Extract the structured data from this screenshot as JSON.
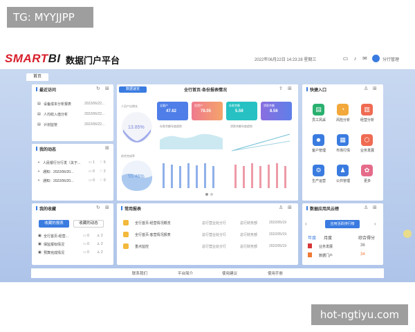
{
  "overlay": {
    "tag": "TG: MYYJJPP",
    "site": "hot-ngtiyu.com"
  },
  "header": {
    "logo_left": "SMART",
    "logo_right": "BI",
    "title": "数据门户平台",
    "datetime": "2022年06月22日 14:23:28 星期三",
    "user": "分行管理",
    "icons": [
      "monitor-icon",
      "bell-icon",
      "message-icon",
      "settings-icon"
    ]
  },
  "tabs": {
    "home": "首页"
  },
  "recent": {
    "title": "最近访问",
    "items": [
      {
        "name": "设备成本分析报表",
        "date": "2022/06/22..."
      },
      {
        "name": "人均收入值分析",
        "date": "2022/06/22..."
      },
      {
        "name": "计划监管",
        "date": "2022/06/22..."
      }
    ]
  },
  "dynamics": {
    "title": "我的动态",
    "items": [
      {
        "text": "人民银行分行发（关于...",
        "like": "1",
        "comment": "5"
      },
      {
        "text": "通知：2022/06/20...",
        "like": "0",
        "comment": "2"
      },
      {
        "text": "通知：2022/06/20...",
        "like": "0",
        "comment": "0"
      }
    ]
  },
  "favorites": {
    "title": "我的收藏",
    "tab_active": "收藏的报表",
    "tab_other": "收藏的动态",
    "items": [
      {
        "text": "全行首页-经营...",
        "a": "0",
        "b": "2"
      },
      {
        "text": "保监报标情况",
        "a": "0",
        "b": "2"
      },
      {
        "text": "预算完成情况",
        "a": "0",
        "b": "2"
      }
    ]
  },
  "dashboard": {
    "title": "数据速览",
    "subtitle": "全行首页-各份报表情况",
    "ring_pct": "13.85%",
    "wave_pct": "55.46%",
    "ring_label": "人员产出增长",
    "wave_label": "综合完成率",
    "cards": [
      {
        "label": "全量户",
        "value": "47.62",
        "color": "#4f7ee8"
      },
      {
        "label": "信贷户",
        "value": "78.05",
        "color": "#ef7a8e"
      },
      {
        "label": "存款余额",
        "value": "5.59",
        "color": "#27c1c3"
      },
      {
        "label": "贷款余额",
        "value": "8.56",
        "color": "#8a6ee0"
      }
    ],
    "mini_chart1": "存款余额年度趋势",
    "mini_chart2": "贷款余额年度趋势"
  },
  "reports": {
    "title": "常用报表",
    "rows": [
      {
        "name": "全行首页-经营情况概览",
        "org": "总行营业处分行",
        "dept": "总行财务部",
        "date": "2022/05/19"
      },
      {
        "name": "全行首页-客营情况报表",
        "org": "总行营业处分行",
        "dept": "总行财务部",
        "date": "2022/05/19"
      },
      {
        "name": "重点监控",
        "org": "总行营业处分行",
        "dept": "总行财务部",
        "date": "2022/05/19"
      }
    ]
  },
  "quick": {
    "title": "快捷入口",
    "items": [
      {
        "label": "员工风采",
        "color": "#29b06f",
        "icon": "▤",
        "name": "staff-icon"
      },
      {
        "label": "风险分析",
        "color": "#f3a83b",
        "icon": "◔",
        "name": "risk-icon"
      },
      {
        "label": "经营分析",
        "color": "#ef6b52",
        "icon": "▥",
        "name": "analysis-icon"
      },
      {
        "label": "客户管理",
        "color": "#3a7be0",
        "icon": "☻",
        "name": "customer-icon"
      },
      {
        "label": "市场行情",
        "color": "#3a7be0",
        "icon": "▦",
        "name": "market-icon"
      },
      {
        "label": "业务发展",
        "color": "#ef6b52",
        "icon": "⬡",
        "name": "business-icon"
      },
      {
        "label": "生产运营",
        "color": "#3a7be0",
        "icon": "⚙",
        "name": "operation-icon"
      },
      {
        "label": "公共管理",
        "color": "#3a7be0",
        "icon": "♟",
        "name": "public-icon"
      },
      {
        "label": "更多",
        "color": "#e56b8a",
        "icon": "✿",
        "name": "more-icon"
      }
    ]
  },
  "ranking": {
    "title": "数据应用风云榜",
    "button": "应用活跃排行榜",
    "col_year": "年度",
    "col_month": "月度",
    "col_score": "综合得分",
    "rows": [
      {
        "name": "业务发展",
        "score": "36"
      },
      {
        "name": "数据门户",
        "score": "34"
      }
    ]
  },
  "footer": {
    "links": [
      "联系我们",
      "平台简介",
      "使用建议",
      "使用手册"
    ]
  }
}
